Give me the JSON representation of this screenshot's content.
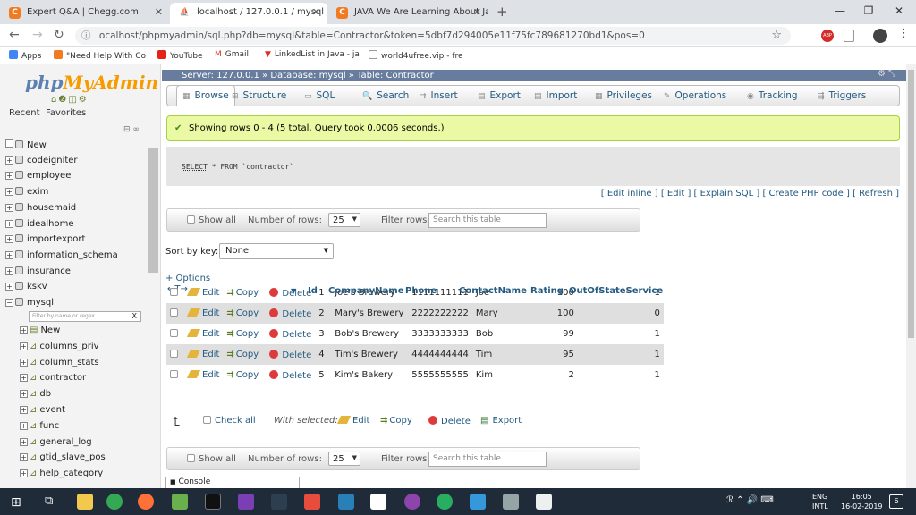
{
  "browser": {
    "tabs": [
      {
        "title": "Expert Q&A | Chegg.com",
        "icon": "C"
      },
      {
        "title": "localhost / 127.0.0.1 / mysql / Co",
        "icon": "pma"
      },
      {
        "title": "JAVA We Are Learning About Jav",
        "icon": "C"
      }
    ],
    "new_tab": "+",
    "url": "localhost/phpmyadmin/sql.php?db=mysql&table=Contractor&token=5dbf7d294005e11f75fc789681270bd1&pos=0",
    "star": "☆",
    "abp": "ABP"
  },
  "bookmarks": [
    {
      "label": "Apps"
    },
    {
      "label": "\"Need Help With Co"
    },
    {
      "label": "YouTube"
    },
    {
      "label": "Gmail"
    },
    {
      "label": "LinkedList in Java - ja"
    },
    {
      "label": "world4ufree.vip - fre"
    }
  ],
  "sidebar": {
    "logo_a": "php",
    "logo_b": "MyAdmin",
    "tabs": [
      "Recent",
      "Favorites"
    ],
    "databases": [
      "New",
      "codeigniter",
      "employee",
      "exim",
      "housemaid",
      "idealhome",
      "importexport",
      "information_schema",
      "insurance",
      "kskv",
      "mysql"
    ],
    "filter_placeholder": "Filter by name or regex",
    "filter_clear": "X",
    "tables": [
      "New",
      "columns_priv",
      "column_stats",
      "contractor",
      "db",
      "event",
      "func",
      "general_log",
      "gtid_slave_pos",
      "help_category"
    ]
  },
  "breadcrumb": "Server: 127.0.0.1 » Database: mysql » Table: Contractor",
  "menu": [
    "Browse",
    "Structure",
    "SQL",
    "Search",
    "Insert",
    "Export",
    "Import",
    "Privileges",
    "Operations",
    "Tracking",
    "Triggers"
  ],
  "success_msg": "Showing rows 0 - 4 (5 total, Query took 0.0006 seconds.)",
  "sql": {
    "select": "SELECT",
    "rest": " * FROM `contractor`"
  },
  "sql_links": "[ Edit inline ] [ Edit ] [ Explain SQL ] [ Create PHP code ] [ Refresh ]",
  "nav": {
    "show_all": "Show all",
    "num_rows_label": "Number of rows:",
    "num_rows": "25",
    "filter_label": "Filter rows:",
    "filter_placeholder": "Search this table"
  },
  "sort": {
    "label": "Sort by key:",
    "value": "None"
  },
  "options": "+ Options",
  "columns": [
    "Id",
    "CompanyName",
    "Phone",
    "ContactName",
    "Rating",
    "OutOfStateService"
  ],
  "actions": {
    "edit": "Edit",
    "copy": "Copy",
    "delete": "Delete"
  },
  "rows": [
    {
      "id": "1",
      "company": "Joe's Brewery",
      "phone": "1111111111",
      "contact": "Joe",
      "rating": "100",
      "oos": "1"
    },
    {
      "id": "2",
      "company": "Mary's Brewery",
      "phone": "2222222222",
      "contact": "Mary",
      "rating": "100",
      "oos": "0"
    },
    {
      "id": "3",
      "company": "Bob's Brewery",
      "phone": "3333333333",
      "contact": "Bob",
      "rating": "99",
      "oos": "1"
    },
    {
      "id": "4",
      "company": "Tim's Brewery",
      "phone": "4444444444",
      "contact": "Tim",
      "rating": "95",
      "oos": "1"
    },
    {
      "id": "5",
      "company": "Kim's Bakery",
      "phone": "5555555555",
      "contact": "Kim",
      "rating": "2",
      "oos": "1"
    }
  ],
  "bulk": {
    "check_all": "Check all",
    "with_selected": "With selected:",
    "edit": "Edit",
    "copy": "Copy",
    "delete": "Delete",
    "export": "Export"
  },
  "console": "Console",
  "taskbar": {
    "lang": "ENG",
    "lang2": "INTL",
    "time": "16:05",
    "date": "16-02-2019",
    "notif": "6"
  }
}
